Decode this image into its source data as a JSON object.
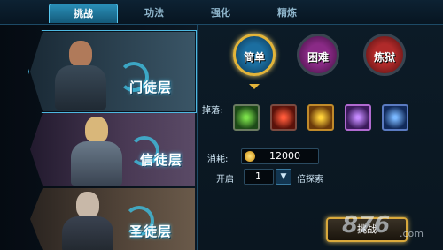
{
  "tabs": [
    {
      "label": "挑战",
      "active": true
    },
    {
      "label": "功法",
      "active": false
    },
    {
      "label": "强化",
      "active": false
    },
    {
      "label": "精炼",
      "active": false
    }
  ],
  "characters": [
    {
      "label": "门徒层",
      "selected": true
    },
    {
      "label": "信徒层",
      "selected": false
    },
    {
      "label": "圣徒层",
      "selected": false
    }
  ],
  "modes": [
    {
      "label": "简单",
      "selected": true
    },
    {
      "label": "困难",
      "selected": false
    },
    {
      "label": "炼狱",
      "selected": false
    }
  ],
  "drops_label": "掉落:",
  "drops": [
    "green-gem-icon",
    "red-orb-icon",
    "gold-chest-icon",
    "purple-chest-icon",
    "blue-chest-icon"
  ],
  "cost_label": "消耗:",
  "cost_value": "12000",
  "open_label": "开启",
  "multiplier_value": "1",
  "multiplier_suffix": "倍探索",
  "challenge_label": "挑战",
  "watermark": "876",
  "watermark_domain": ".com",
  "colors": {
    "accent": "#4db8e0",
    "gold": "#e2b43a"
  }
}
